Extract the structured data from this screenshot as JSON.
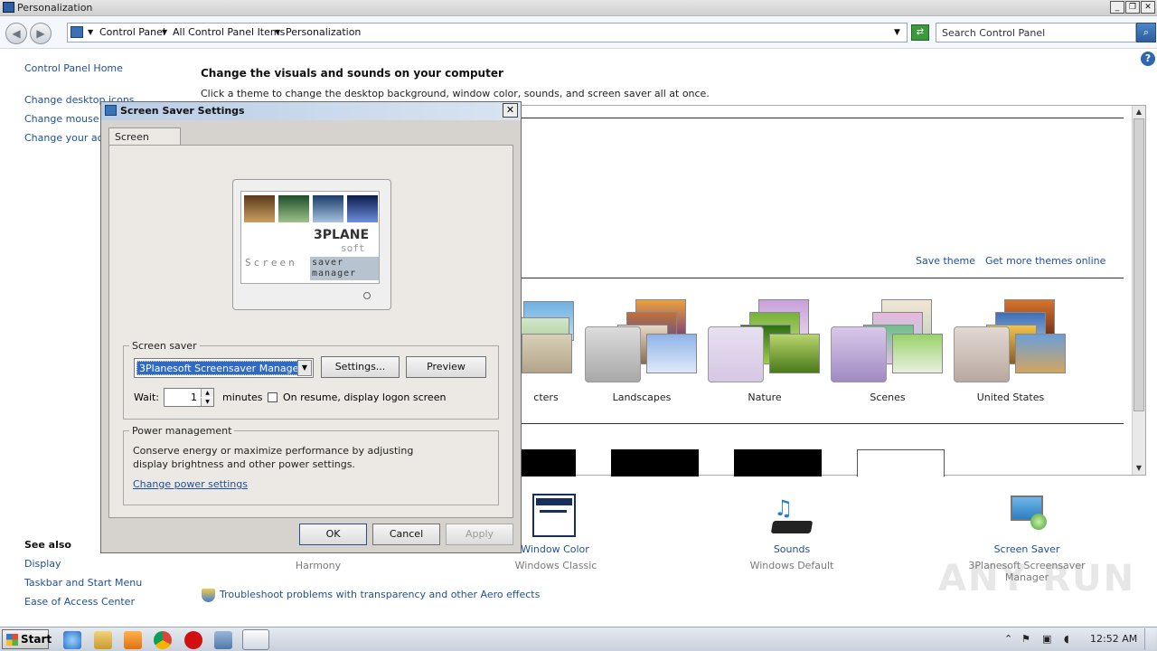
{
  "window": {
    "title": "Personalization",
    "controls": {
      "minimize": "_",
      "maximize": "❐",
      "close": "✕"
    }
  },
  "address": {
    "crumbs": [
      "Control Panel",
      "All Control Panel Items",
      "Personalization"
    ],
    "search_placeholder": "Search Control Panel"
  },
  "sidebar": {
    "home": "Control Panel Home",
    "items": [
      "Change desktop icons",
      "Change mouse pointers",
      "Change your account picture"
    ],
    "see_also_title": "See also",
    "see_also": [
      "Display",
      "Taskbar and Start Menu",
      "Ease of Access Center"
    ]
  },
  "main": {
    "heading": "Change the visuals and sounds on your computer",
    "subheading": "Click a theme to change the desktop background, window color, sounds, and screen saver all at once.",
    "save_theme": "Save theme",
    "get_more": "Get more themes online",
    "themes": [
      "cters",
      "Landscapes",
      "Nature",
      "Scenes",
      "United States"
    ],
    "bottom": [
      {
        "name": "",
        "sub": "Harmony"
      },
      {
        "name": "Window Color",
        "sub": "Windows Classic"
      },
      {
        "name": "Sounds",
        "sub": "Windows Default"
      },
      {
        "name": "Screen Saver",
        "sub": "3Planesoft Screensaver Manager"
      }
    ],
    "troubleshoot": "Troubleshoot problems with transparency and other Aero effects"
  },
  "dialog": {
    "title": "Screen Saver Settings",
    "tab": "Screen Saver",
    "preview_brand_line1": "3PLANE",
    "preview_brand_line2": "soft",
    "preview_caption_left": "Screen",
    "preview_caption_right": "saver manager",
    "screen_saver_group": "Screen saver",
    "selected": "3Planesoft Screensaver Manager",
    "settings_btn": "Settings...",
    "preview_btn": "Preview",
    "wait_label": "Wait:",
    "wait_value": "1",
    "minutes_label": "minutes",
    "resume_label": "On resume, display logon screen",
    "power_group": "Power management",
    "power_text": "Conserve energy or maximize performance by adjusting display brightness and other power settings.",
    "power_link": "Change power settings",
    "ok": "OK",
    "cancel": "Cancel",
    "apply": "Apply"
  },
  "taskbar": {
    "start": "Start",
    "clock": "12:52 AM"
  },
  "watermark": "ANY RUN"
}
